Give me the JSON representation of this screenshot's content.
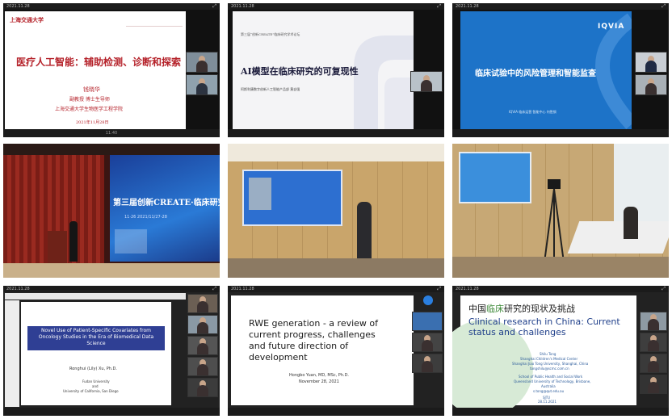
{
  "tile1": {
    "logo": "上海交通大学",
    "title": "医疗人工智能：辅助检测、诊断和探索",
    "speaker": "钱晓华",
    "role": "副教授 博士生导师",
    "affil": "上海交通大学生物医学工程学院",
    "date": "2021年11月28日",
    "bottom_time": "11:40"
  },
  "tile2": {
    "header": "第三届“创新CREATE”临床研究学术论坛",
    "title": "AI模型在临床研究的可复现性",
    "subtitle": "阿斯利康数字创新人工智能产品部 黄自强"
  },
  "tile3": {
    "logo": "IQVIA",
    "title": "临床试验中的风险管理和智能监查",
    "subtitle": "IQVIA 临床运营 智能中心 何胜钢"
  },
  "tile4": {
    "banner": "第三届创新CREATE·临床研究学术论坛",
    "banner_date": "11·26 2021/11/27-28"
  },
  "tile7": {
    "title": "Novel Use of Patient-Specific Covariates from Oncology Studies in the Era of Biomedical Data Science",
    "author": "Ronghui (Lily) Xu, Ph.D.",
    "affil1": "Fudan University",
    "affil2": "and",
    "affil3": "University of California, San Diego"
  },
  "tile8": {
    "title": "RWE generation - a review of current progress, challenges and future direction of development",
    "author": "Hongbo Yuan, MD, MSc, Ph.D.",
    "date": "November 28, 2021"
  },
  "tile9": {
    "title_cn_a": "中国",
    "title_cn_b": "临床",
    "title_cn_c": "研究的现状及挑战",
    "title_en": "Clinical research in China: Current status and challenges",
    "name": "Shilu Tong",
    "org1": "Shanghai Children's Medical Center",
    "org2": "Shanghai Jiao Tong University, Shanghai, China",
    "email1": "tongshilu@scmc.com.cn",
    "org3": "School of Public Health and Social Work",
    "org4": "Queensland University of Technology, Brisbane,",
    "org5": "Australia",
    "email2": "s.tong@qut.edu.au",
    "foot1": "SJTU",
    "foot2": "28.11.2021"
  },
  "colors": {
    "iqvia_blue": "#1d73c8",
    "create_blue": "#1e3c8c",
    "red_title": "#b5222a",
    "rwe_navy": "#2b3a8f"
  }
}
